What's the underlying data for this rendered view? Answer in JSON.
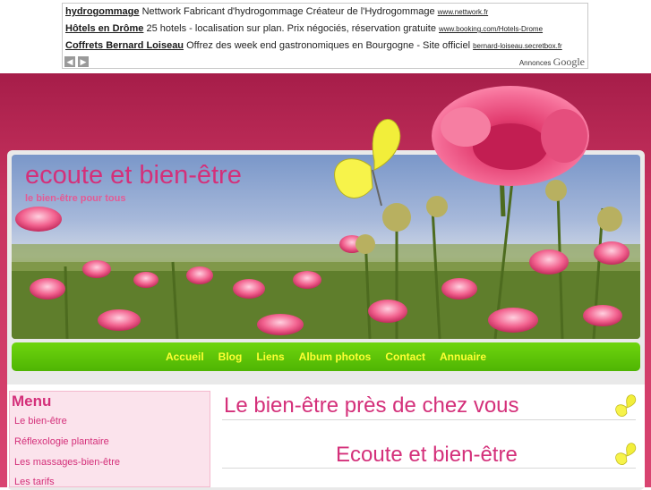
{
  "ads": {
    "items": [
      {
        "title": "hydrogommage",
        "text": "Nettwork Fabricant d'hydrogommage Créateur de l'Hydrogommage",
        "url": "www.nettwork.fr"
      },
      {
        "title": "Hôtels en Drôme",
        "text": "25 hotels - localisation sur plan. Prix négociés, réservation gratuite",
        "url": "www.booking.com/Hotels-Drome"
      },
      {
        "title": "Coffrets Bernard Loiseau",
        "text": "Offrez des week end gastronomiques en Bourgogne - Site officiel",
        "url": "bernard-loiseau.secretbox.fr"
      }
    ],
    "brand_prefix": "Annonces",
    "brand_name": "Google"
  },
  "site": {
    "title": "ecoute et bien-être",
    "subtitle": "le bien-être pour tous"
  },
  "nav": {
    "items": [
      "Accueil",
      "Blog",
      "Liens",
      "Album photos",
      "Contact",
      "Annuaire"
    ]
  },
  "sidebar": {
    "title": "Menu",
    "items": [
      "Le bien-être",
      "Réflexologie plantaire",
      "Les massages-bien-être",
      "Les tarifs"
    ]
  },
  "main": {
    "heading1": "Le bien-être près de chez vous",
    "heading2": "Ecoute et bien-être"
  },
  "colors": {
    "accent": "#d4307a",
    "nav_green": "#5cc106",
    "nav_text": "#ffff33",
    "background": "#c8335f"
  }
}
